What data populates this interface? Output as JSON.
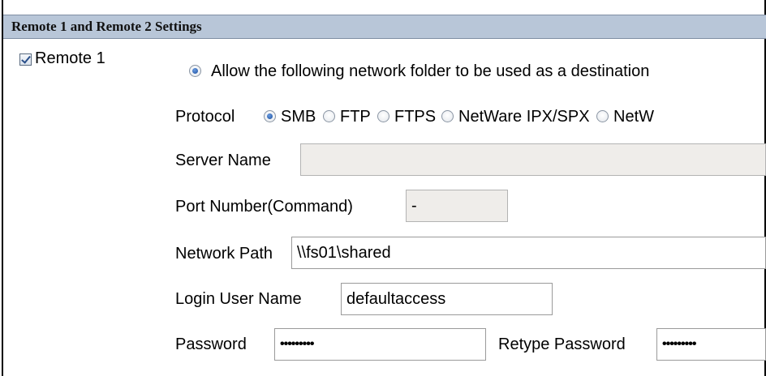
{
  "header": {
    "title": "Remote 1 and Remote 2 Settings"
  },
  "remote1": {
    "checkbox_label": "Remote 1",
    "checked": true,
    "allow_label": "Allow the following network folder to be used as a destination",
    "protocol": {
      "label": "Protocol",
      "options": [
        "SMB",
        "FTP",
        "FTPS",
        "NetWare IPX/SPX",
        "NetW"
      ],
      "selected": "SMB"
    },
    "server_name": {
      "label": "Server Name",
      "value": ""
    },
    "port_number": {
      "label": "Port Number(Command)",
      "value": "-"
    },
    "network_path": {
      "label": "Network Path",
      "value": "\\\\fs01\\shared"
    },
    "login_user": {
      "label": "Login User Name",
      "value": "defaultaccess"
    },
    "password": {
      "label": "Password",
      "value": "•••••••••"
    },
    "retype_password": {
      "label": "Retype Password",
      "value": "•••••••••"
    }
  }
}
